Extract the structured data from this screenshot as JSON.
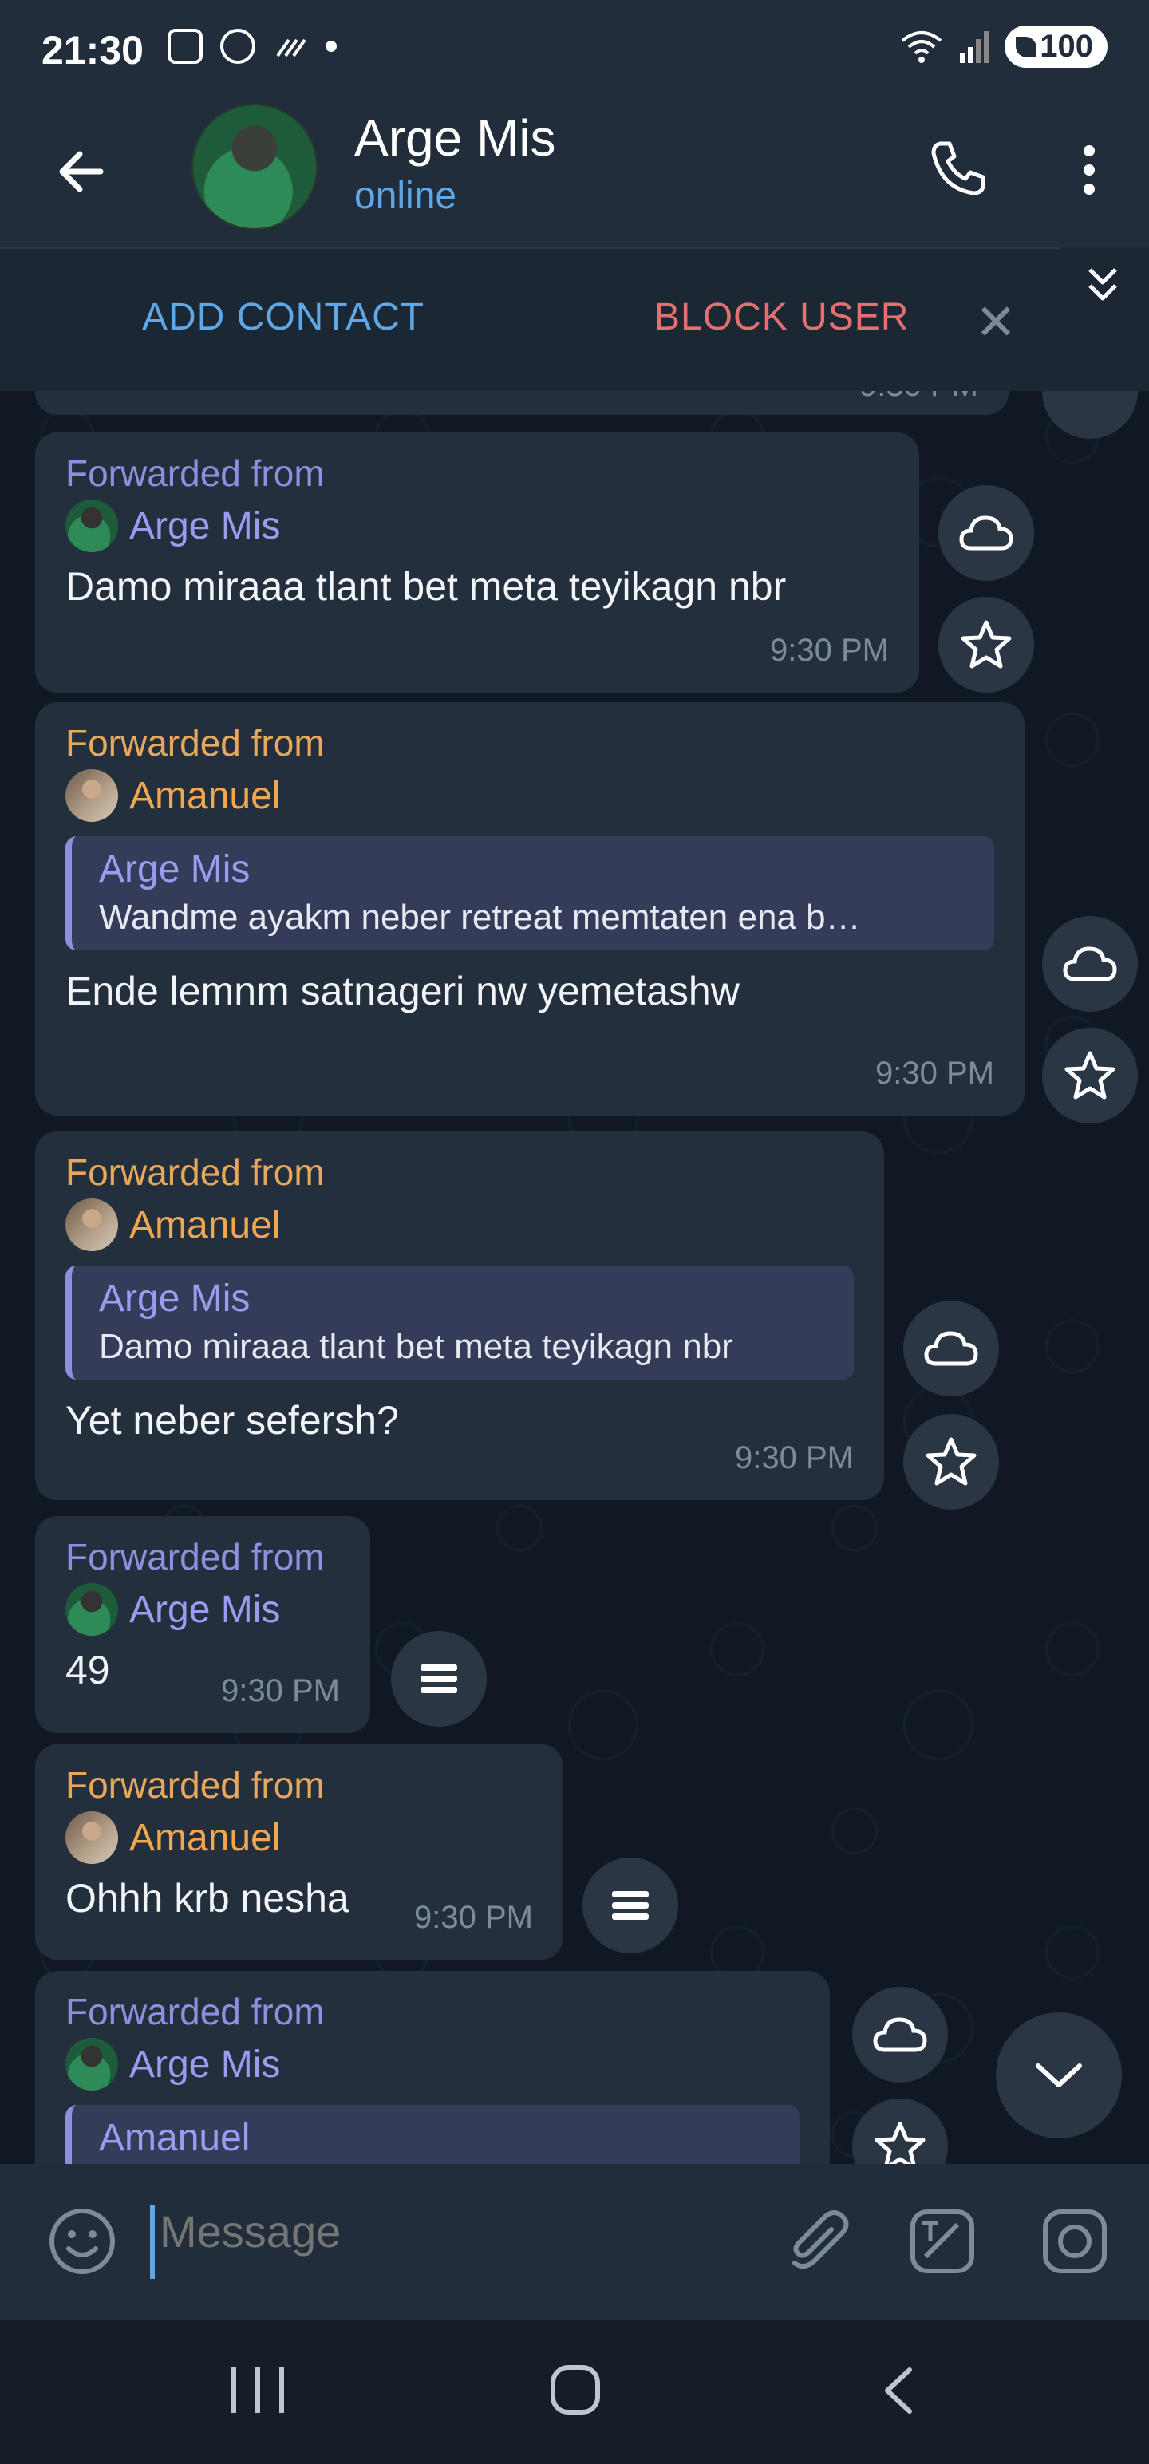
{
  "status_bar": {
    "time": "21:30",
    "battery": "100"
  },
  "header": {
    "name": "Arge Mis",
    "status": "online"
  },
  "actions": {
    "add_contact": "ADD CONTACT",
    "block_user": "BLOCK USER",
    "partial_time": "9:30 PM"
  },
  "messages": [
    {
      "fwd_label": "Forwarded from",
      "sender": "Arge Mis",
      "text": "Damo miraaa tlant bet meta teyikagn nbr",
      "time": "9:30 PM"
    },
    {
      "fwd_label": "Forwarded from",
      "sender": "Amanuel",
      "quote_name": "Arge Mis",
      "quote_text": "Wandme ayakm neber retreat memtaten ena  b…",
      "text": "Ende lemnm satnageri nw yemetashw",
      "time": "9:30 PM"
    },
    {
      "fwd_label": "Forwarded from",
      "sender": "Amanuel",
      "quote_name": "Arge Mis",
      "quote_text": "Damo miraaa tlant bet meta teyikagn nbr",
      "text": "Yet neber sefersh?",
      "time": "9:30 PM"
    },
    {
      "fwd_label": "Forwarded from",
      "sender": "Arge Mis",
      "text": "49",
      "time": "9:30 PM"
    },
    {
      "fwd_label": "Forwarded from",
      "sender": "Amanuel",
      "text": "Ohhh krb nesha",
      "time": "9:30 PM"
    },
    {
      "fwd_label": "Forwarded from",
      "sender": "Arge Mis",
      "quote_name": "Amanuel"
    }
  ],
  "input": {
    "placeholder": "Message"
  },
  "icons": {
    "back": "arrow-left-icon",
    "call": "phone-icon",
    "menu": "more-vertical-icon",
    "close": "close-icon",
    "collapse": "chevrons-down-icon",
    "cloud": "cloud-icon",
    "star": "star-icon",
    "list": "list-icon",
    "emoji": "smile-icon",
    "attach": "paperclip-icon",
    "sticker": "sticker-icon",
    "camera": "camera-icon",
    "scroll": "chevron-down-icon"
  },
  "colors": {
    "accent_blue": "#5fa8e8",
    "block_red": "#e36f6f",
    "fwd_purple": "#9b9bf0",
    "fwd_orange": "#f0a850",
    "bubble": "#242f3d"
  }
}
